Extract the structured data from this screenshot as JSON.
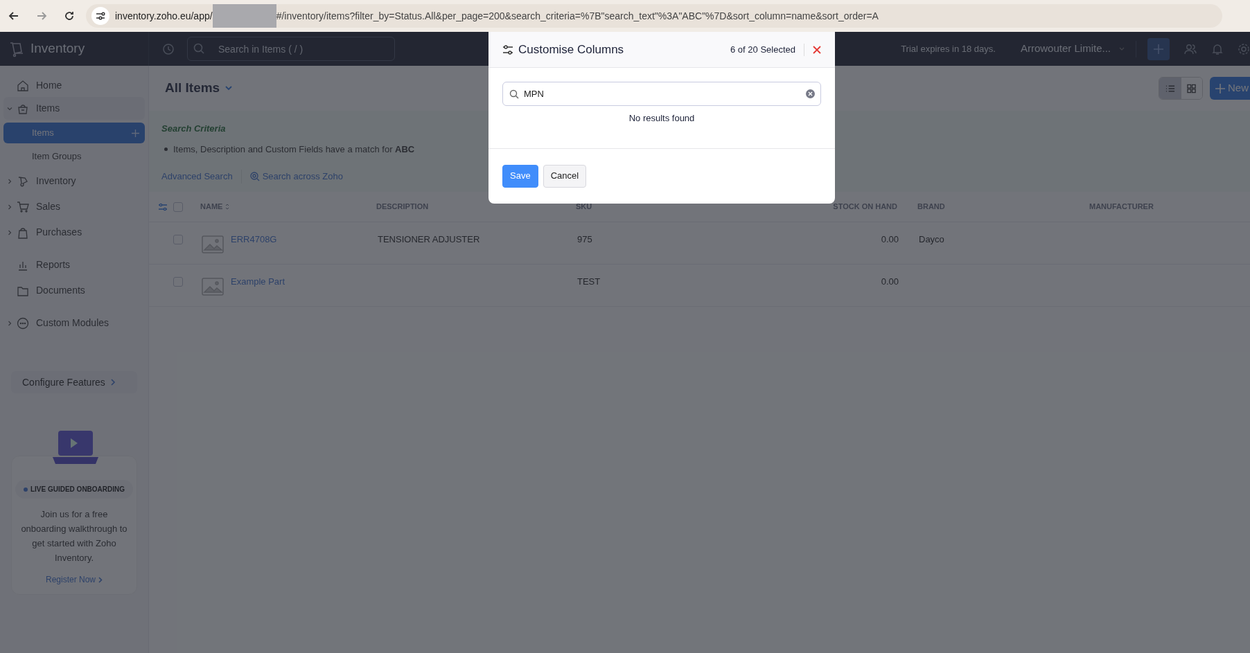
{
  "browser": {
    "url_start": "inventory.zoho.eu/app/",
    "url_end": "#/inventory/items?filter_by=Status.All&per_page=200&search_criteria=%7B\"search_text\"%3A\"ABC\"%7D&sort_column=name&sort_order=A"
  },
  "app_header": {
    "logo_text": "Inventory",
    "search_placeholder": "Search in Items ( / )",
    "trial_text": "Trial expires in 18 days.",
    "org_name": "Arrowouter Limite..."
  },
  "sidebar": {
    "sections": [
      [
        {
          "label": "Home"
        },
        {
          "label": "Items",
          "expanded": true,
          "children": [
            {
              "label": "Items",
              "selected": true
            },
            {
              "label": "Item Groups",
              "selected": false
            }
          ]
        },
        {
          "label": "Inventory",
          "expanded": false
        },
        {
          "label": "Sales",
          "expanded": false
        },
        {
          "label": "Purchases",
          "expanded": false
        }
      ],
      [
        {
          "label": "Reports"
        },
        {
          "label": "Documents"
        }
      ],
      [
        {
          "label": "Custom Modules",
          "expanded": false
        }
      ]
    ],
    "configure_button": "Configure Features",
    "onboarding": {
      "badge": "LIVE GUIDED ONBOARDING",
      "text": "Join us for a free onboarding walkthrough to get started with Zoho Inventory.",
      "link": "Register Now"
    }
  },
  "page": {
    "title": "All Items",
    "new_button": "New",
    "view_modes": [
      {
        "selected": true
      },
      {
        "selected": false
      }
    ]
  },
  "search_criteria": {
    "heading": "Search Criteria",
    "text": "Items, Description and Custom Fields have a match for **ABC**",
    "links": [
      "Advanced Search",
      "Search across Zoho"
    ]
  },
  "table": {
    "all_checked": false,
    "columns": [
      {
        "label": "NAME",
        "kind": "sortable"
      },
      {
        "label": "DESCRIPTION",
        "kind": "text"
      },
      {
        "label": "SKU",
        "kind": "text"
      },
      {
        "label": "STOCK ON HAND",
        "kind": "number"
      },
      {
        "label": "BRAND",
        "kind": "text"
      },
      {
        "label": "MANUFACTURER",
        "kind": "text"
      }
    ],
    "rows": [
      {
        "checked": false,
        "cells": [
          "ERR4708G",
          "TENSIONER ADJUSTER",
          "975",
          "0.00",
          "Dayco",
          ""
        ]
      },
      {
        "checked": false,
        "cells": [
          "Example Part",
          "",
          "TEST",
          "0.00",
          "",
          ""
        ]
      }
    ]
  },
  "modal": {
    "title": "Customise Columns",
    "count": "6 of 20 Selected",
    "search_value": "MPN",
    "empty_message": "No results found",
    "buttons": [
      {
        "label": "Save",
        "kind": "primary"
      },
      {
        "label": "Cancel",
        "kind": "secondary"
      }
    ]
  }
}
